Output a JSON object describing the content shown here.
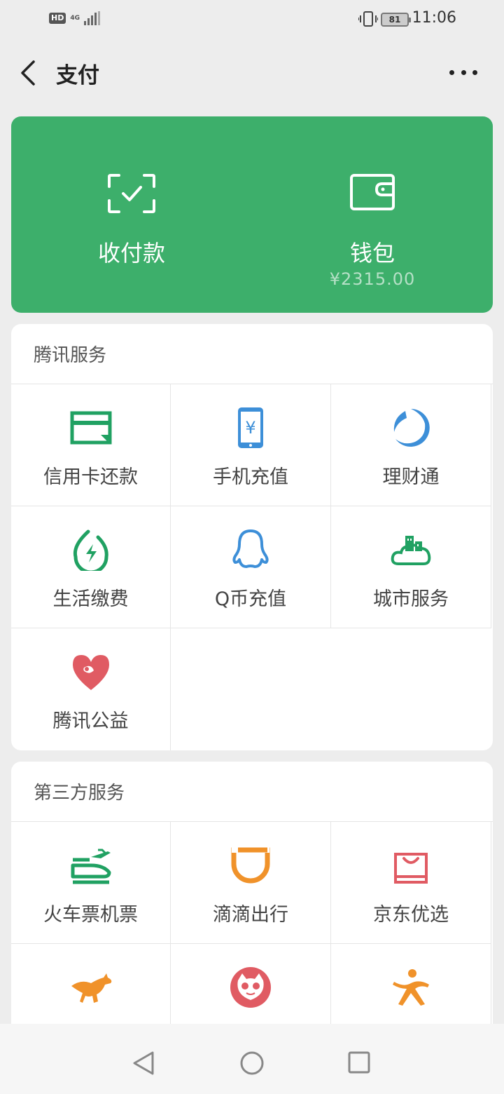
{
  "status_bar": {
    "hd": "HD",
    "network": "4G",
    "battery": "81",
    "time": "11:06"
  },
  "header": {
    "title": "支付"
  },
  "pay_card": {
    "receive_label": "收付款",
    "wallet_label": "钱包",
    "wallet_balance": "¥2315.00",
    "color": "#3daf6b"
  },
  "tencent_services": {
    "title": "腾讯服务",
    "items": [
      {
        "label": "信用卡还款",
        "icon": "credit-card-icon"
      },
      {
        "label": "手机充值",
        "icon": "mobile-topup-icon"
      },
      {
        "label": "理财通",
        "icon": "wealth-icon"
      },
      {
        "label": "生活缴费",
        "icon": "utility-bill-icon"
      },
      {
        "label": "Q币充值",
        "icon": "qq-coin-icon"
      },
      {
        "label": "城市服务",
        "icon": "city-services-icon"
      },
      {
        "label": "腾讯公益",
        "icon": "charity-icon"
      }
    ]
  },
  "third_party_services": {
    "title": "第三方服务",
    "items": [
      {
        "label": "火车票机票",
        "icon": "train-plane-icon"
      },
      {
        "label": "滴滴出行",
        "icon": "didi-icon"
      },
      {
        "label": "京东优选",
        "icon": "jd-shopping-icon"
      },
      {
        "label": "",
        "icon": "kangaroo-icon"
      },
      {
        "label": "",
        "icon": "cat-icon"
      },
      {
        "label": "",
        "icon": "person-icon"
      }
    ]
  }
}
